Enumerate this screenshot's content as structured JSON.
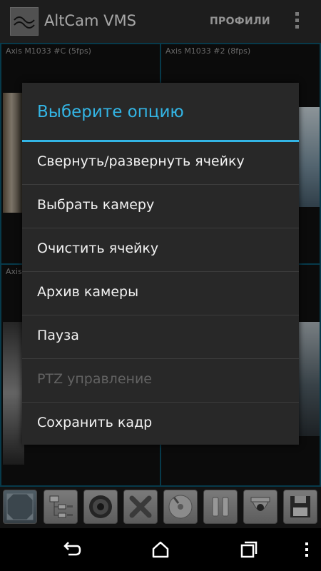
{
  "action_bar": {
    "app_title": "AltCam VMS",
    "profiles_label": "ПРОФИЛИ",
    "overflow_icon": "overflow-menu-icon"
  },
  "grid": {
    "cells": [
      {
        "label": "Axis M1033 #C (5fps)"
      },
      {
        "label": "Axis M1033 #2 (8fps)"
      },
      {
        "label": "Axis"
      },
      {
        "label": ""
      }
    ]
  },
  "dialog": {
    "title": "Выберите опцию",
    "accent_color": "#33b5e5",
    "options": [
      {
        "label": "Свернуть/развернуть ячейку",
        "enabled": true
      },
      {
        "label": "Выбрать камеру",
        "enabled": true
      },
      {
        "label": "Очистить ячейку",
        "enabled": true
      },
      {
        "label": "Архив камеры",
        "enabled": true
      },
      {
        "label": "Пауза",
        "enabled": true
      },
      {
        "label": "PTZ управление",
        "enabled": false
      },
      {
        "label": "Сохранить кадр",
        "enabled": true
      }
    ]
  },
  "toolbar": {
    "buttons": [
      {
        "icon": "grid-layout-icon"
      },
      {
        "icon": "camera-list-icon"
      },
      {
        "icon": "speaker-icon"
      },
      {
        "icon": "close-icon"
      },
      {
        "icon": "disc-archive-icon"
      },
      {
        "icon": "pause-icon"
      },
      {
        "icon": "ptz-camera-icon"
      },
      {
        "icon": "save-floppy-icon"
      }
    ]
  },
  "nav_bar": {
    "buttons": [
      "back-icon",
      "home-icon",
      "recent-apps-icon",
      "menu-icon"
    ]
  }
}
